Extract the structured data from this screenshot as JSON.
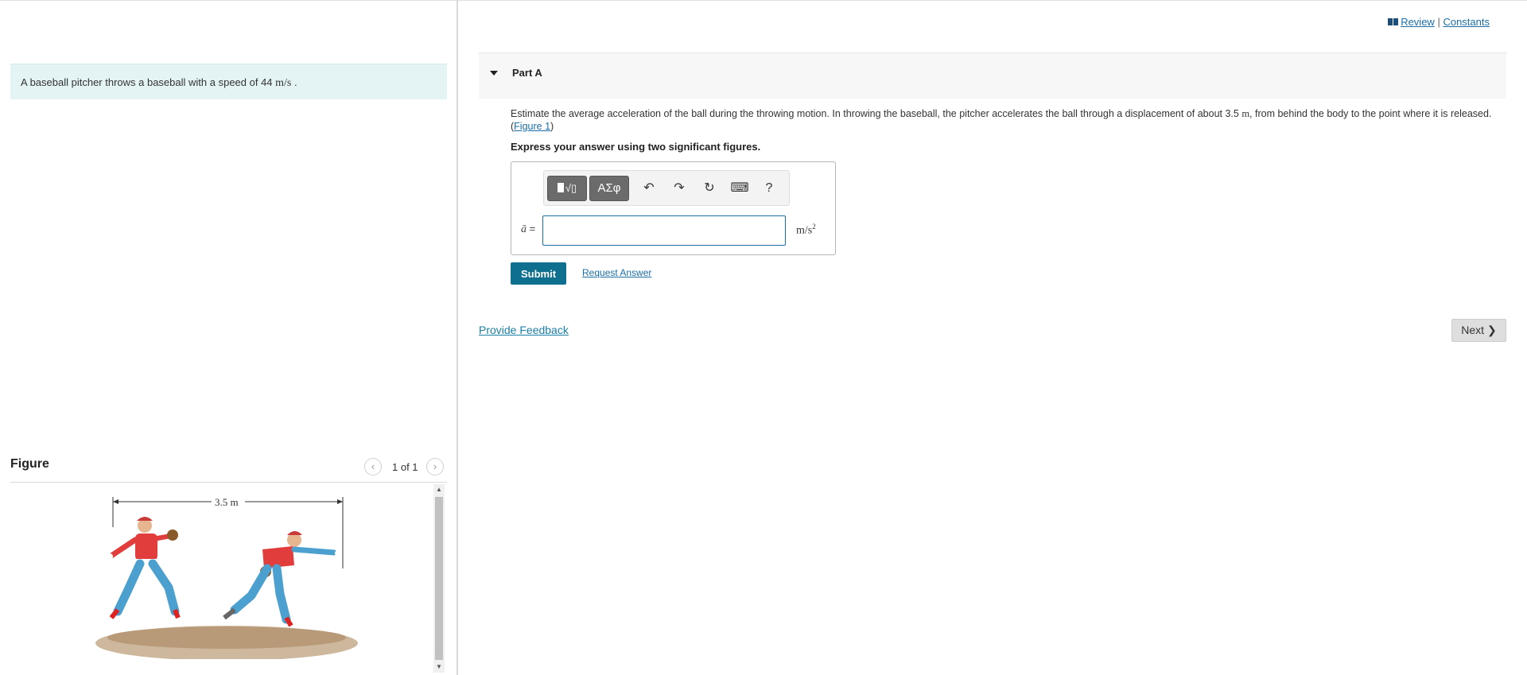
{
  "intro": {
    "text_before": "A baseball pitcher throws a baseball with a speed of 44 ",
    "unit": "m/s",
    "text_after": " ."
  },
  "figure": {
    "title": "Figure",
    "counter": "1 of 1",
    "dimension_label": "3.5 m"
  },
  "toplinks": {
    "review": "Review",
    "separator": "|",
    "constants": "Constants"
  },
  "part": {
    "title": "Part A",
    "question_before": "Estimate the average acceleration of the ball during the throwing motion. In throwing the baseball, the pitcher accelerates the ball through a displacement of about 3.5 ",
    "question_unit": "m",
    "question_after": ", from behind the body to the point where it is released. (",
    "figure_link": "Figure 1",
    "question_close": ")",
    "instruction": "Express your answer using two significant figures."
  },
  "answer": {
    "symbol": "ā",
    "equals": " =",
    "value": "",
    "unit": "m/s",
    "unit_exp": "2"
  },
  "toolbar": {
    "templates_label": "√▯",
    "symbols_label": "ΑΣφ",
    "undo": "↶",
    "redo": "↷",
    "reset": "↻",
    "keyboard": "⌨",
    "help": "?"
  },
  "actions": {
    "submit": "Submit",
    "request_answer": "Request Answer",
    "provide_feedback": "Provide Feedback",
    "next": "Next"
  },
  "colors": {
    "intro_bg": "#e4f4f4",
    "submit_bg": "#0e6f8f",
    "link": "#1a6ea8"
  }
}
